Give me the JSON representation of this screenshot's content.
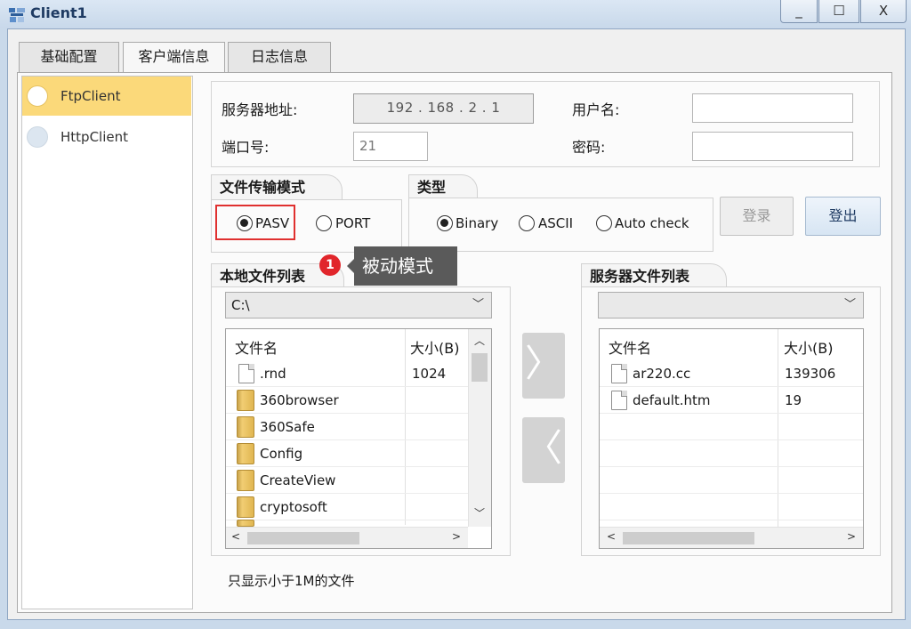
{
  "window": {
    "title": "Client1",
    "min_label": "_",
    "max_label": "☐",
    "close_label": "X"
  },
  "tabs": [
    {
      "label": "基础配置"
    },
    {
      "label": "客户端信息"
    },
    {
      "label": "日志信息"
    }
  ],
  "clients": [
    {
      "label": "FtpClient",
      "selected": true
    },
    {
      "label": "HttpClient",
      "selected": false
    }
  ],
  "server": {
    "addr_label": "服务器地址:",
    "ip_value": "192  .  168  .  2  .  1",
    "port_label": "端口号:",
    "port_value": "21",
    "user_label": "用户名:",
    "user_value": "",
    "pass_label": "密码:",
    "pass_value": ""
  },
  "transfer_mode": {
    "title": "文件传输模式",
    "options": [
      {
        "label": "PASV",
        "checked": true
      },
      {
        "label": "PORT",
        "checked": false
      }
    ]
  },
  "type": {
    "title": "类型",
    "options": [
      {
        "label": "Binary",
        "checked": true
      },
      {
        "label": "ASCII",
        "checked": false
      },
      {
        "label": "Auto check",
        "checked": false
      }
    ]
  },
  "buttons": {
    "login": "登录",
    "logout": "登出"
  },
  "annotation": {
    "number": "1",
    "text": "被动模式",
    "color": "#e1262b"
  },
  "local_files": {
    "title": "本地文件列表",
    "path": "C:\\",
    "col_name": "文件名",
    "col_size": "大小(B)",
    "rows": [
      {
        "name": ".rnd",
        "size": "1024",
        "icon": "file-icon"
      },
      {
        "name": "360browser",
        "size": "",
        "icon": "folder-icon"
      },
      {
        "name": "360Safe",
        "size": "",
        "icon": "folder-icon"
      },
      {
        "name": "Config",
        "size": "",
        "icon": "folder-icon"
      },
      {
        "name": "CreateView",
        "size": "",
        "icon": "folder-icon"
      },
      {
        "name": "cryptosoft",
        "size": "",
        "icon": "folder-icon"
      }
    ]
  },
  "server_files": {
    "title": "服务器文件列表",
    "path": "",
    "col_name": "文件名",
    "col_size": "大小(B)",
    "rows": [
      {
        "name": "ar220.cc",
        "size": "139306",
        "icon": "file-icon"
      },
      {
        "name": "default.htm",
        "size": "19",
        "icon": "file-icon"
      }
    ]
  },
  "transfer": {
    "upload_glyph": "〉",
    "download_glyph": "〈"
  },
  "footnote": "只显示小于1M的文件",
  "colors": {
    "selected_item": "#fbd97a",
    "highlight_border": "#e0302f",
    "annotation_bg": "#5a5a5a"
  }
}
